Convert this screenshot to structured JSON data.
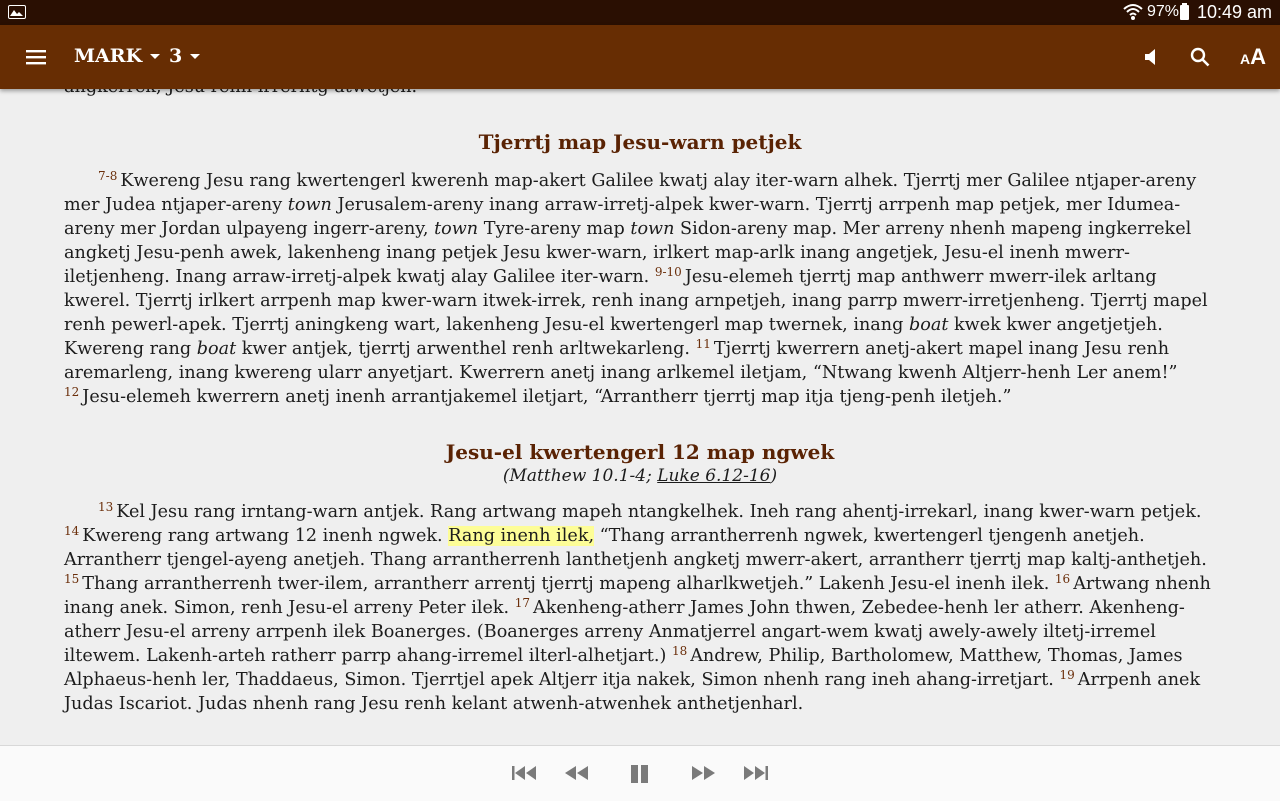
{
  "status_bar": {
    "battery_percent": "97%",
    "time": "10:49 am"
  },
  "app_bar": {
    "book": "MARK",
    "chapter": "3",
    "icons": [
      "menu-icon",
      "speaker-icon",
      "search-icon",
      "text-size-icon"
    ],
    "text_size_label_small": "A",
    "text_size_label_big": "A"
  },
  "content": {
    "top_fragment": "angkerrek, Jesu renh irrerntg atwetjeh.",
    "section1": {
      "heading": "Tjerrtj map Jesu-warn petjek",
      "para1": {
        "v7_8": "7-8",
        "t1": "Kwereng Jesu rang kwertengerl kwerenh map-akert Galilee kwatj alay iter-warn alhek. Tjerrtj mer Galilee ntjaper-areny mer Judea ntjaper-areny ",
        "town1": "town",
        "t2": " Jerusalem-areny inang arraw-irretj-alpek kwer-warn. Tjerrtj arrpenh map petjek, mer Idumea-areny mer Jordan ulpayeng ingerr-areny, ",
        "town2": "town",
        "t3": " Tyre-areny map ",
        "town3": "town",
        "t4": " Sidon-areny map. Mer arreny nhenh mapeng ingkerrekel angketj Jesu-penh awek, lakenheng inang petjek Jesu kwer-warn, irlkert map-arlk inang angetjek, Jesu-el inenh mwerr-iletjenheng. Inang arraw-irretj-alpek kwatj alay Galilee iter-warn. ",
        "v9_10": "9-10",
        "t5": "Jesu-elemeh tjerrtj map anthwerr mwerr-ilek arltang kwerel. Tjerrtj irlkert arrpenh map kwer-warn itwek-irrek, renh inang arnpetjeh, inang parrp mwerr-irretjenheng. Tjerrtj mapel renh pewerl-apek. Tjerrtj aningkeng wart, lakenheng Jesu-el kwertengerl map twernek, inang ",
        "boat1": "boat",
        "t6": " kwek kwer angetjetjeh. Kwereng rang ",
        "boat2": "boat",
        "t7": " kwer antjek, tjerrtj arwenthel renh arltwekarleng. ",
        "v11": "11",
        "t8": "Tjerrtj kwerrern anetj-akert mapel inang Jesu renh aremarleng, inang kwereng ularr anyetjart. Kwerrern anetj inang arlkemel iletjam, “Ntwang kwenh Altjerr-henh Ler anem!” ",
        "v12": "12",
        "t9": "Jesu-elemeh kwerrern anetj inenh arrantjakemel iletjart, “Arrantherr tjerrtj map itja tjeng-penh iletjeh.”"
      }
    },
    "section2": {
      "heading": "Jesu-el kwertengerl 12 map ngwek",
      "xref_prefix": "(Matthew 10.1-4; ",
      "xref_link": "Luke 6.12-16",
      "xref_suffix": ")",
      "para1": {
        "v13": "13",
        "t1": "Kel Jesu rang irntang-warn antjek. Rang artwang mapeh ntangkelhek. Ineh rang ahentj-irrekarl, inang kwer-warn petjek. ",
        "v14": "14",
        "t2": "Kwereng rang artwang 12 inenh ngwek. ",
        "highlight": "Rang inenh ilek,",
        "t3": " “Thang arrantherrenh ngwek, kwertengerl tjengenh anetjeh. Arrantherr tjengel-ayeng anetjeh. Thang arrantherrenh lanthetjenh angketj mwerr-akert, arrantherr tjerrtj map kaltj-anthetjeh. ",
        "v15": "15",
        "t4": "Thang arrantherrenh twer-ilem, arrantherr arrentj tjerrtj mapeng alharlkwetjeh.” Lakenh Jesu-el inenh ilek. ",
        "v16": "16",
        "t5": "Artwang nhenh inang anek. Simon, renh Jesu-el arreny Peter ilek. ",
        "v17": "17",
        "t6": "Akenheng-atherr James John thwen, Zebedee-henh ler atherr. Akenheng-atherr Jesu-el arreny arrpenh ilek Boanerges. (Boanerges arreny Anmatjerrel angart-wem kwatj awely-awely iltetj-irremel iltewem. Lakenh-arteh ratherr parrp ahang-irremel ilterl-alhetjart.) ",
        "v18": "18",
        "t7": "Andrew, Philip, Bartholomew, Matthew, Thomas, James Alphaeus-henh ler, Thaddaeus, Simon. Tjerrtjel apek Altjerr itja nakek, Simon nhenh rang ineh ahang-irretjart. ",
        "v19": "19",
        "t8": "Arrpenh anek Judas Iscariot. Judas nhenh rang Jesu renh kelant atwenh-atwenhek anthetjenharl."
      }
    }
  },
  "player": {
    "controls": [
      "skip-to-start-icon",
      "rewind-icon",
      "pause-icon",
      "fast-forward-icon",
      "skip-to-end-icon"
    ]
  },
  "colors": {
    "status_bar": "#2a0f02",
    "app_bar": "#672d03",
    "heading": "#5a2304",
    "verse_number": "#6b2f0b",
    "highlight": "#fdfd97",
    "page_background": "#efefef"
  }
}
